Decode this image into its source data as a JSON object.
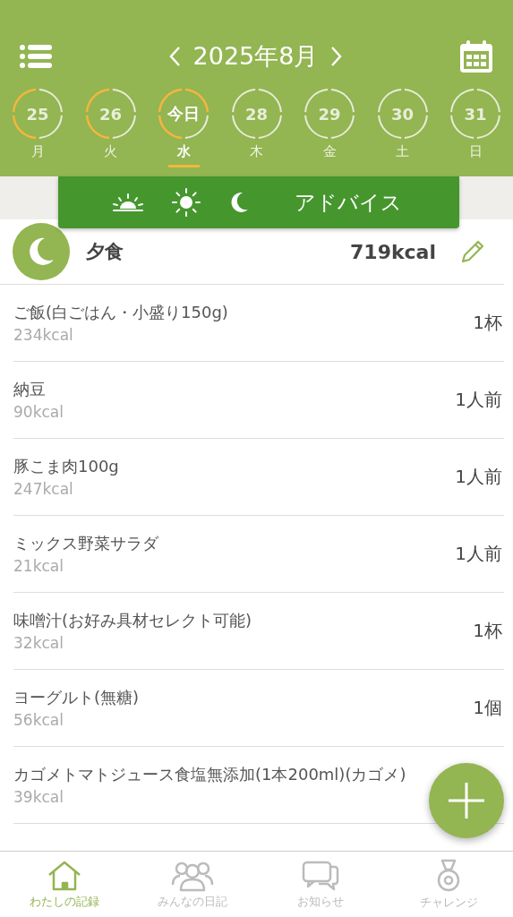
{
  "header": {
    "month": "2025年8月"
  },
  "days": [
    {
      "date": "25",
      "weekday": "月",
      "segments": [
        true,
        true,
        false,
        false
      ],
      "selected": false
    },
    {
      "date": "26",
      "weekday": "火",
      "segments": [
        true,
        true,
        false,
        false
      ],
      "selected": false
    },
    {
      "date": "今日",
      "weekday": "水",
      "segments": [
        true,
        true,
        true,
        false
      ],
      "selected": true
    },
    {
      "date": "28",
      "weekday": "木",
      "segments": [
        false,
        false,
        false,
        false
      ],
      "selected": false
    },
    {
      "date": "29",
      "weekday": "金",
      "segments": [
        false,
        false,
        false,
        false
      ],
      "selected": false
    },
    {
      "date": "30",
      "weekday": "土",
      "segments": [
        false,
        false,
        false,
        false
      ],
      "selected": false
    },
    {
      "date": "31",
      "weekday": "日",
      "segments": [
        false,
        false,
        false,
        false
      ],
      "selected": false
    }
  ],
  "meal_tabs": {
    "advice": "アドバイス"
  },
  "meal": {
    "name": "夕食",
    "total": "719kcal"
  },
  "items": [
    {
      "name": "ご飯(白ごはん・小盛り150g)",
      "kcal": "234kcal",
      "amount": "1杯"
    },
    {
      "name": "納豆",
      "kcal": "90kcal",
      "amount": "1人前"
    },
    {
      "name": "豚こま肉100g",
      "kcal": "247kcal",
      "amount": "1人前"
    },
    {
      "name": "ミックス野菜サラダ",
      "kcal": "21kcal",
      "amount": "1人前"
    },
    {
      "name": "味噌汁(お好み具材セレクト可能)",
      "kcal": "32kcal",
      "amount": "1杯"
    },
    {
      "name": "ヨーグルト(無糖)",
      "kcal": "56kcal",
      "amount": "1個"
    },
    {
      "name": "カゴメトマトジュース食塩無添加(1本200ml)(カゴメ)",
      "kcal": "39kcal"
    }
  ],
  "bottom_nav": [
    {
      "label": "わたしの記録",
      "kind": "home",
      "selected": true
    },
    {
      "label": "みんなの日記",
      "kind": "people",
      "selected": false
    },
    {
      "label": "お知らせ",
      "kind": "chat",
      "selected": false
    },
    {
      "label": "チャレンジ",
      "kind": "medal",
      "selected": false
    }
  ]
}
